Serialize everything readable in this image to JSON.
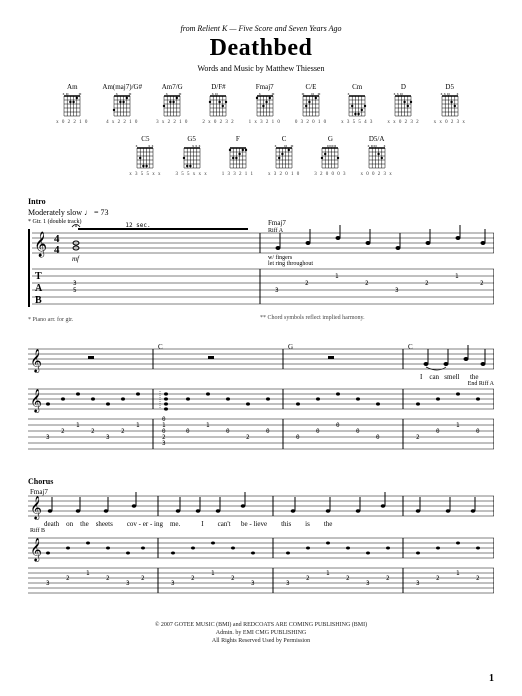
{
  "header": {
    "source": "from Relient K — Five Score and Seven Years Ago",
    "title": "Deathbed",
    "credits": "Words and Music by Matthew Thiessen"
  },
  "chord_defs": [
    {
      "name": "Am",
      "frets": "x02210"
    },
    {
      "name": "Am(maj7)/G#",
      "frets": "4x2210"
    },
    {
      "name": "Am7/G",
      "frets": "3x2210"
    },
    {
      "name": "D/F#",
      "frets": "2x0232"
    },
    {
      "name": "Fmaj7",
      "frets": "1x3210"
    },
    {
      "name": "C/E",
      "frets": "032010"
    },
    {
      "name": "Cm",
      "frets": "x35543"
    },
    {
      "name": "D",
      "frets": "xx0232"
    },
    {
      "name": "D5",
      "frets": "xx023x"
    },
    {
      "name": "C5",
      "frets": "x355xx"
    },
    {
      "name": "G5",
      "frets": "355xxx"
    },
    {
      "name": "F",
      "frets": "133211"
    },
    {
      "name": "C",
      "frets": "x32010"
    },
    {
      "name": "G",
      "frets": "320003"
    },
    {
      "name": "D5/A",
      "frets": "x0023x"
    }
  ],
  "intro": {
    "label": "Intro",
    "tempo": "Moderately slow ♩ = 73",
    "gtr_note": "* Gtr. 1 (double track)",
    "tremolo": "12 sec.",
    "dynamic": "mf",
    "technique1": "w/ fingers",
    "technique2": "let ring throughout",
    "footnote1": "* Piano arr. for gtr.",
    "footnote2": "** Chord symbols reflect implied harmony.",
    "chord_over": "Fmaj7",
    "riff": "Riff A"
  },
  "system2": {
    "chords": [
      "C",
      "G",
      "C"
    ],
    "lyric_fragment": "I    can   smell      the",
    "end_label": "End Riff A"
  },
  "chorus": {
    "label": "Chorus",
    "chord": "Fmaj7",
    "lyrics": "death    on    the    sheets        cov - er - ing    me.            I        can't      be - lieve        this        is        the",
    "riff": "Riff B"
  },
  "copyright": {
    "line1": "© 2007 GOTEE MUSIC (BMI) and REDCOATS ARE COMING PUBLISHING (BMI)",
    "line2": "Admin. by EMI CMG PUBLISHING",
    "line3": "All Rights Reserved   Used by Permission"
  },
  "page_number": "1"
}
